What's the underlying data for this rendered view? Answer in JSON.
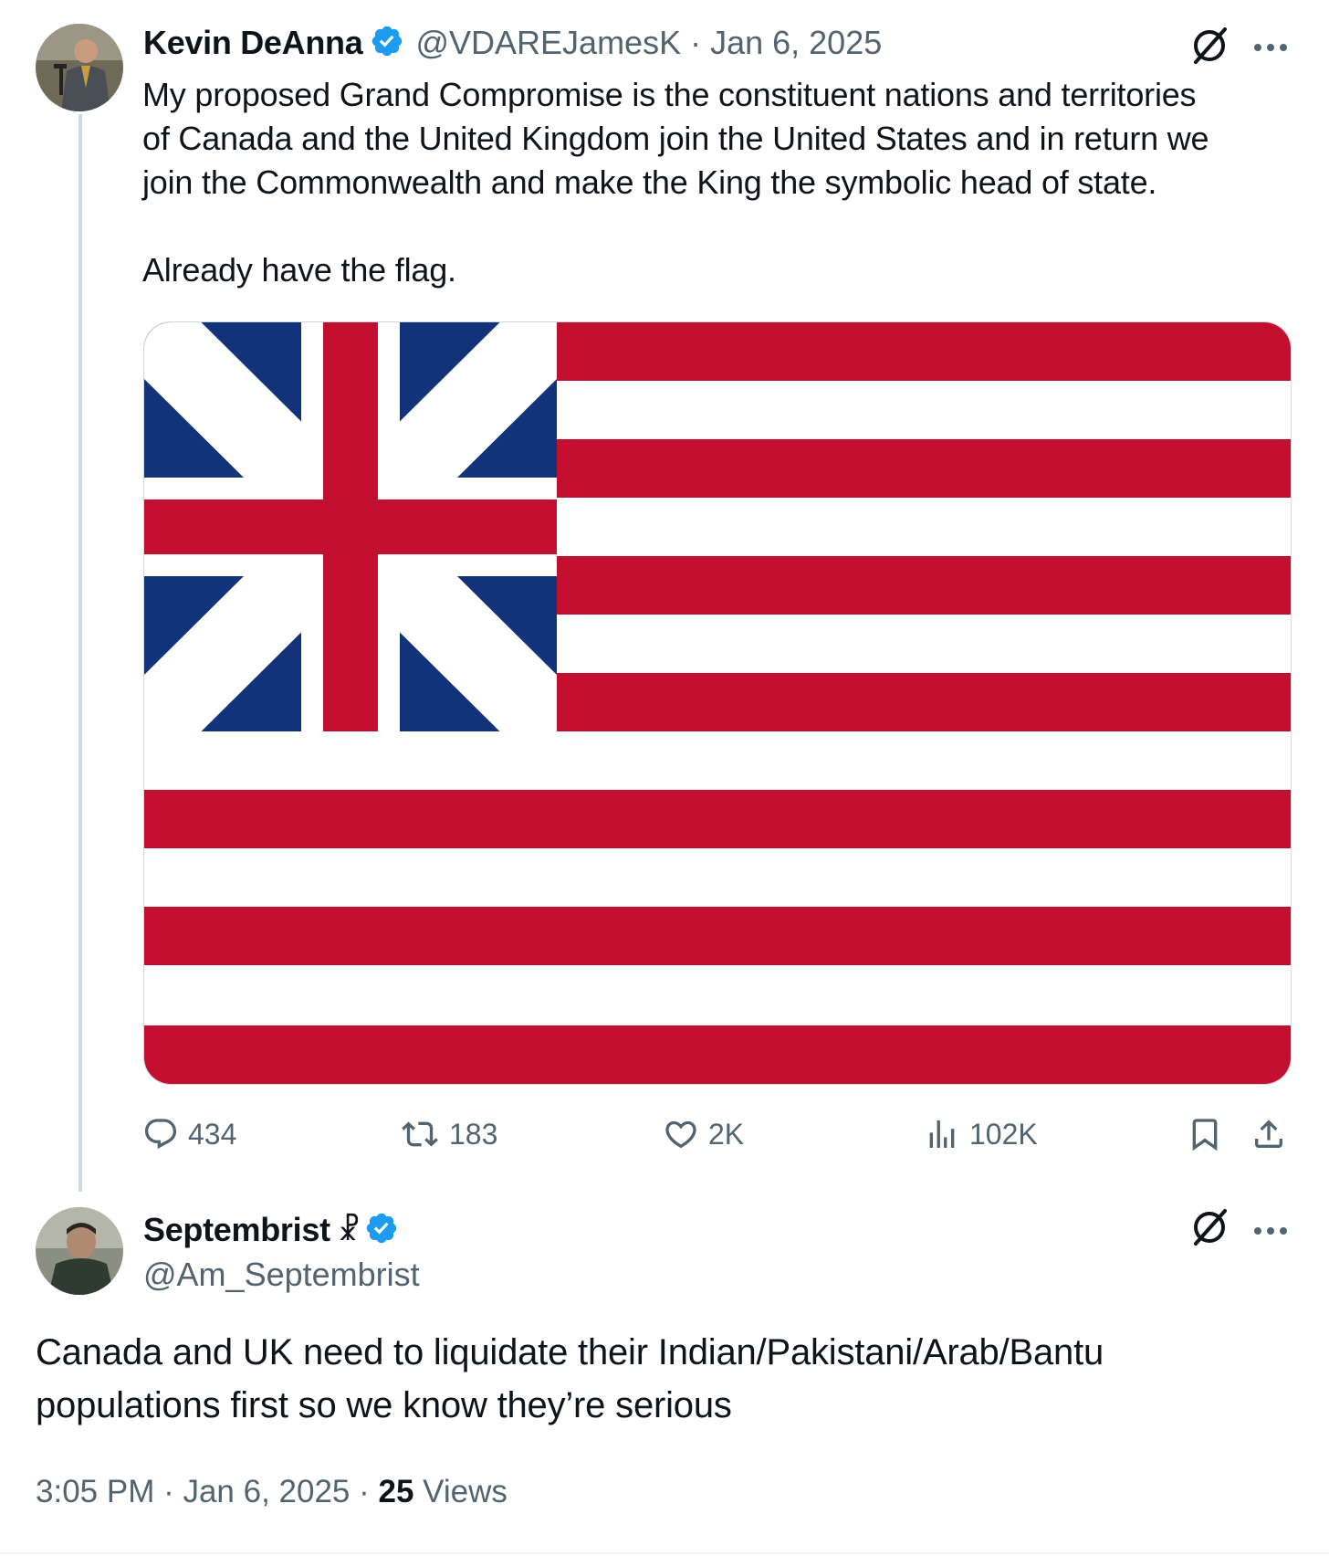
{
  "tweet1": {
    "author_name": "Kevin DeAnna",
    "handle_date": "@VDAREJamesK · Jan 6, 2025",
    "text_line1": "My proposed Grand Compromise is the constituent nations and territories",
    "text_line2": "of Canada and the United Kingdom join the United States and in return we",
    "text_line3": "join the Commonwealth and make the King the symbolic head of state.",
    "text_line4": "Already have the flag.",
    "stats": {
      "replies": "434",
      "reposts": "183",
      "likes": "2K",
      "views": "102K"
    }
  },
  "tweet2": {
    "author_name": "Septembrist",
    "name_symbol": "☧",
    "handle": "@Am_Septembrist",
    "text_line1": "Canada and UK need to liquidate their Indian/Pakistani/Arab/Bantu",
    "text_line2": "populations first so we know they’re serious",
    "time": "3:05 PM · Jan 6, 2025 · ",
    "views_count": "25",
    "views_label": " Views"
  },
  "icons": [
    "grok-icon",
    "more-icon",
    "verified-badge-icon",
    "reply-icon",
    "repost-icon",
    "like-icon",
    "views-icon",
    "bookmark-icon",
    "share-icon"
  ],
  "colors": {
    "verified": "#1d9bf0",
    "flag_red": "#c20f2f",
    "flag_blue": "#12327a",
    "muted": "#536471"
  }
}
